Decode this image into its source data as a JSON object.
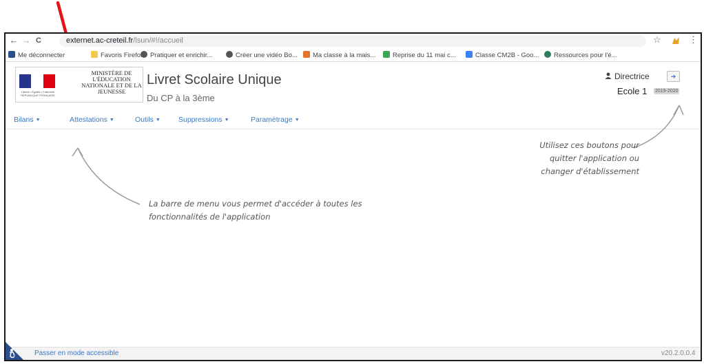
{
  "browser": {
    "back_glyph": "←",
    "forward_glyph": "→",
    "reload_glyph": "C",
    "url_host": "externet.ac-creteil.fr",
    "url_path": "/lsun/#!/accueil",
    "star_glyph": "☆",
    "menu_glyph": "⋮",
    "bookmarks": [
      {
        "label": "Me déconnecter",
        "icon": "ent-icon",
        "color": "#2b4e8c"
      },
      {
        "label": "Favoris Firefox",
        "icon": "folder-icon",
        "color": "#f2c94c"
      },
      {
        "label": "Pratiquer et enrichir...",
        "icon": "globe-icon",
        "color": "#555555"
      },
      {
        "label": "Créer une vidéo Bo...",
        "icon": "globe-icon",
        "color": "#555555"
      },
      {
        "label": "Ma classe à la mais...",
        "icon": "grid-icon",
        "color": "#e8712c"
      },
      {
        "label": "Reprise du 11 mai c...",
        "icon": "sheets-icon",
        "color": "#3aa757"
      },
      {
        "label": "Classe CM2B - Goo...",
        "icon": "drive-icon",
        "color": "#3b82f6"
      },
      {
        "label": "Ressources pour l'é...",
        "icon": "globe-icon",
        "color": "#2e7d5b"
      }
    ]
  },
  "header": {
    "ministry": "MINISTÈRE DE L'ÉDUCATION NATIONALE ET DE LA JEUNESSE",
    "motto": "Liberté • Égalité • Fraternité RÉPUBLIQUE FRANÇAISE",
    "title": "Livret Scolaire Unique",
    "subtitle": "Du CP à la 3ème",
    "user": "Directrice",
    "school": "Ecole 1",
    "year": "2019-2020"
  },
  "menu": [
    "Bilans",
    "Attestations",
    "Outils",
    "Suppressions",
    "Paramétrage"
  ],
  "annotations": {
    "menu_note_line1": "La barre de menu vous permet d'accéder à toutes les",
    "menu_note_line2": "fonctionnalités de l'application",
    "buttons_note_line1": "Utilisez ces boutons pour",
    "buttons_note_line2": "quitter l'application ou",
    "buttons_note_line3": "changer d'établissement"
  },
  "footer": {
    "accessible": "Passer en mode accessible",
    "version": "v20.2.0.0.4"
  },
  "colors": {
    "accent": "#3a78c2",
    "arrow": "#e3131b"
  }
}
